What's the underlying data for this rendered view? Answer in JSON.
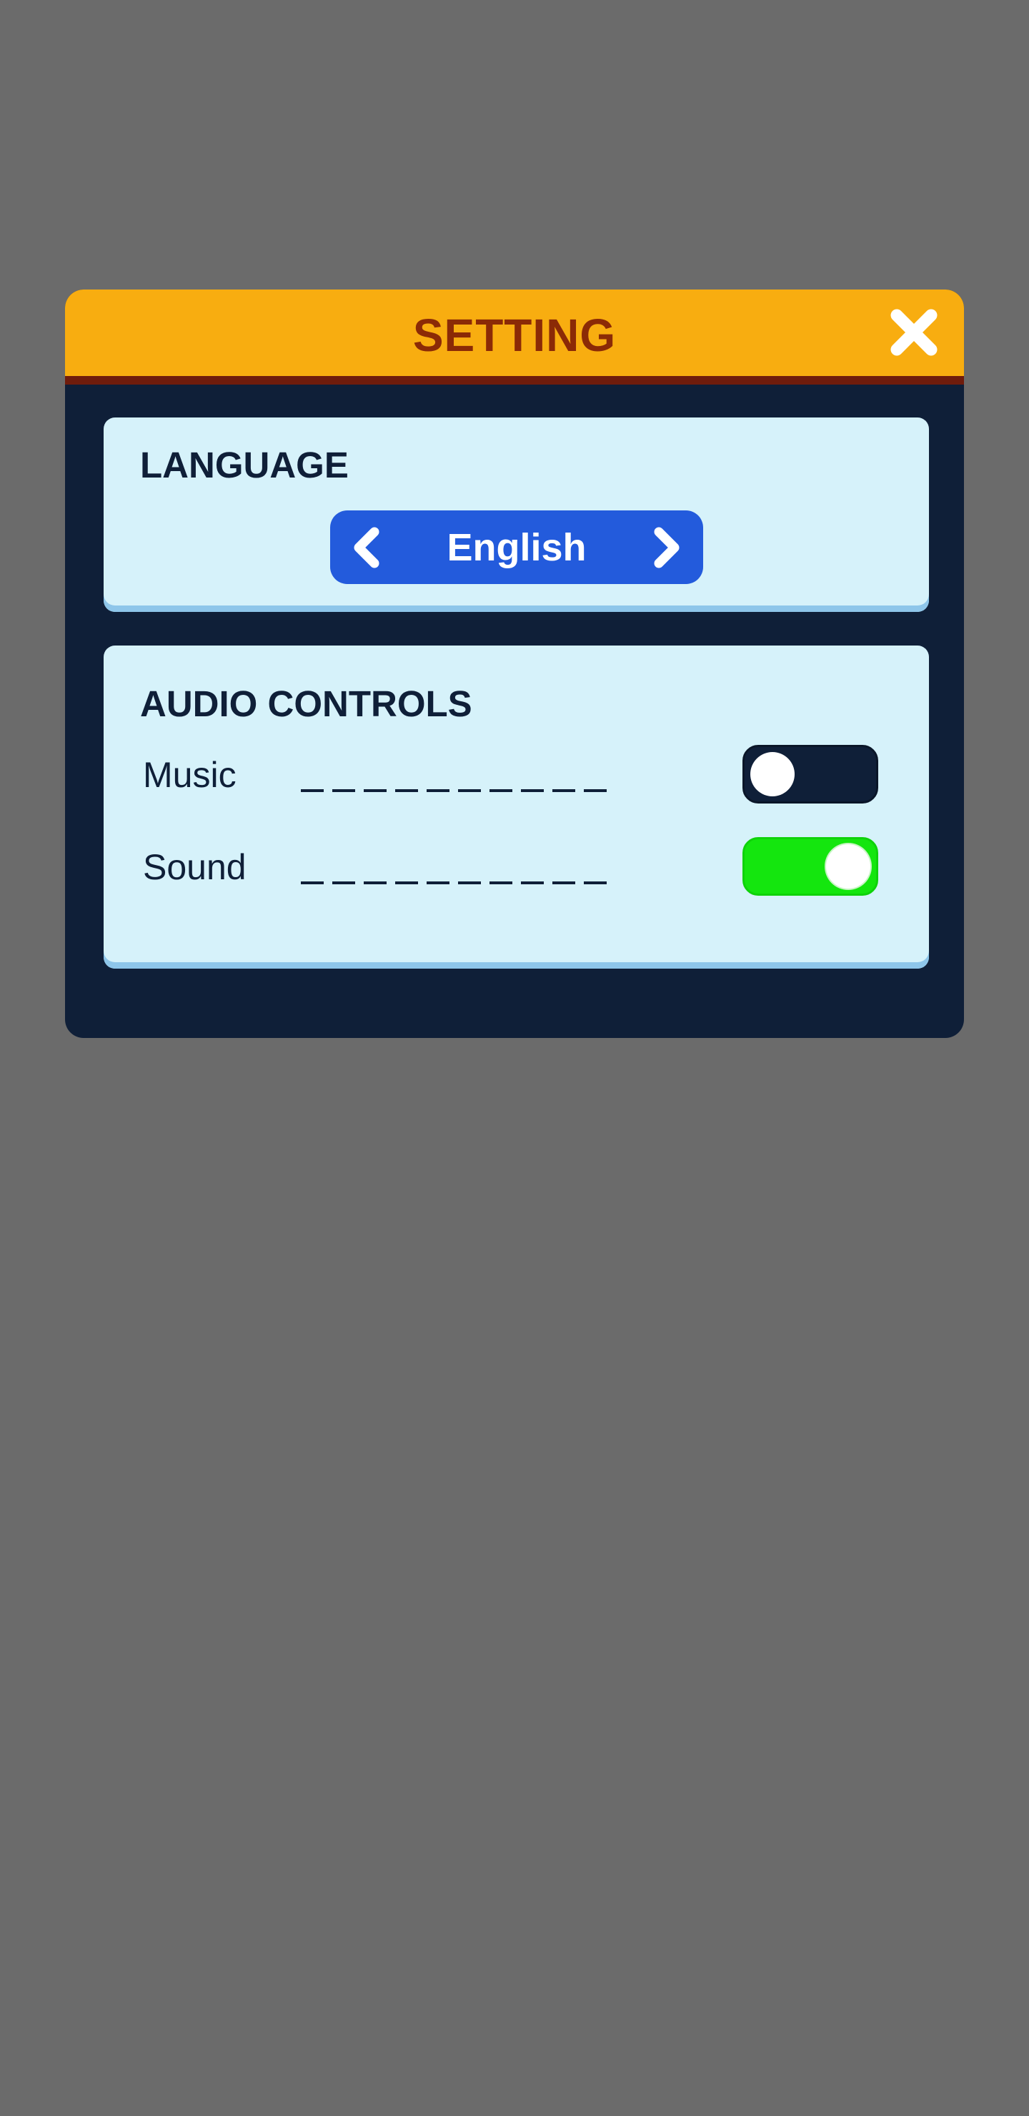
{
  "dialog": {
    "title": "SETTING",
    "close_icon": "close-icon"
  },
  "language": {
    "title": "LANGUAGE",
    "value": "English",
    "prev_icon": "chevron-left-icon",
    "next_icon": "chevron-right-icon"
  },
  "audio": {
    "title": "AUDIO CONTROLS",
    "rows": [
      {
        "label": "Music",
        "enabled": false
      },
      {
        "label": "Sound",
        "enabled": true
      }
    ]
  },
  "colors": {
    "background": "#6b6b6b",
    "dialog_body": "#0f1f38",
    "header": "#f8ad10",
    "title_text": "#8b2a06",
    "card": "#d6f2fa",
    "selector": "#235bdc",
    "toggle_on": "#14e60e",
    "toggle_off": "#0f1f38"
  }
}
